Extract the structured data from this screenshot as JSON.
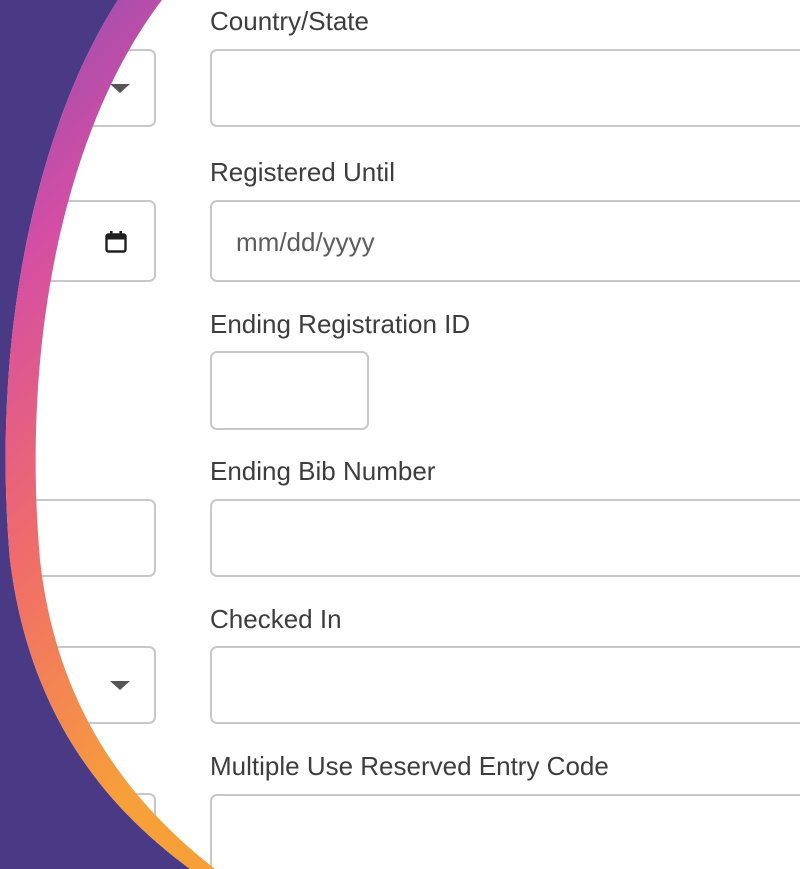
{
  "form": {
    "fields": [
      {
        "label": "Country/State",
        "value": ""
      },
      {
        "label": "Registered Until",
        "placeholder": "mm/dd/yyyy"
      },
      {
        "label": "Ending Registration ID",
        "value": ""
      },
      {
        "label": "Ending Bib Number",
        "value": ""
      },
      {
        "label": "Checked In",
        "value": ""
      },
      {
        "label": "Multiple Use Reserved Entry Code",
        "value": ""
      }
    ]
  },
  "theme": {
    "accent_purple": "#4a3a85",
    "accent_gradient": [
      "#9b59b6",
      "#e0559c",
      "#f4794f",
      "#f7a13a"
    ],
    "border": "#c8c8c8"
  }
}
